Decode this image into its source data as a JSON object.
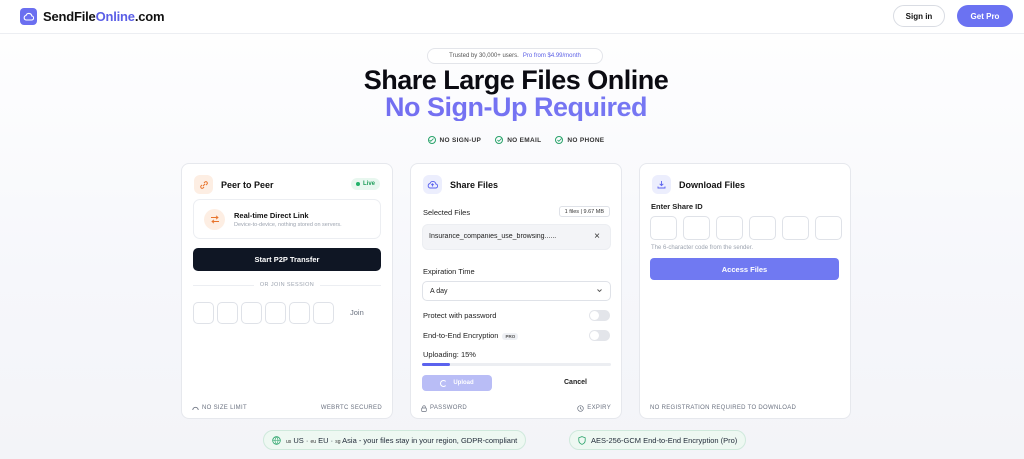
{
  "header": {
    "logo_main": "SendFile",
    "logo_accent": "Online",
    "logo_suffix": ".com",
    "signin_label": "Sign in",
    "getpro_label": "Get Pro"
  },
  "hero": {
    "trust_text": "Trusted by 30,000+ users.",
    "trust_pro": "Pro from $4.99/month",
    "title": "Share Large Files Online",
    "subtitle": "No Sign-Up Required",
    "features": [
      "NO SIGN-UP",
      "NO EMAIL",
      "NO PHONE"
    ]
  },
  "p2p": {
    "title": "Peer to Peer",
    "badge": "Live",
    "rt_title": "Real-time Direct Link",
    "rt_desc": "Device-to-device, nothing stored on servers.",
    "start_label": "Start P2P Transfer",
    "or_join": "OR JOIN SESSION",
    "join_label": "Join",
    "foot_left": "NO SIZE LIMIT",
    "foot_right": "WEBRTC SECURED"
  },
  "share": {
    "title": "Share Files",
    "selected_label": "Selected Files",
    "file_count": "1 files | 9.67 MB",
    "file_name": "Insurance_companies_use_browsing......",
    "expiration_label": "Expiration Time",
    "expiration_value": "A day",
    "password_label": "Protect with password",
    "e2e_label": "End-to-End Encryption",
    "pro_tag": "PRO",
    "uploading_label": "Uploading: 15%",
    "progress": 0.15,
    "upload_label": "Upload",
    "cancel_label": "Cancel",
    "foot_left": "PASSWORD",
    "foot_right": "EXPIRY"
  },
  "download": {
    "title": "Download Files",
    "enter_label": "Enter Share ID",
    "hint": "The 6-character code from the sender.",
    "access_label": "Access Files",
    "foot": "NO REGISTRATION REQUIRED TO DOWNLOAD"
  },
  "bottom": {
    "region_us_flag": "us",
    "region_us": "US",
    "region_eu_flag": "eu",
    "region_eu": "EU",
    "region_asia_flag": "sg",
    "region_text": "Asia - your files stay in your region, GDPR-compliant",
    "encryption_text": "AES-256-GCM End-to-End Encryption (Pro)"
  },
  "colors": {
    "brand": "#6b72f2",
    "dark_button": "#0f1624",
    "success": "#29a36a"
  }
}
